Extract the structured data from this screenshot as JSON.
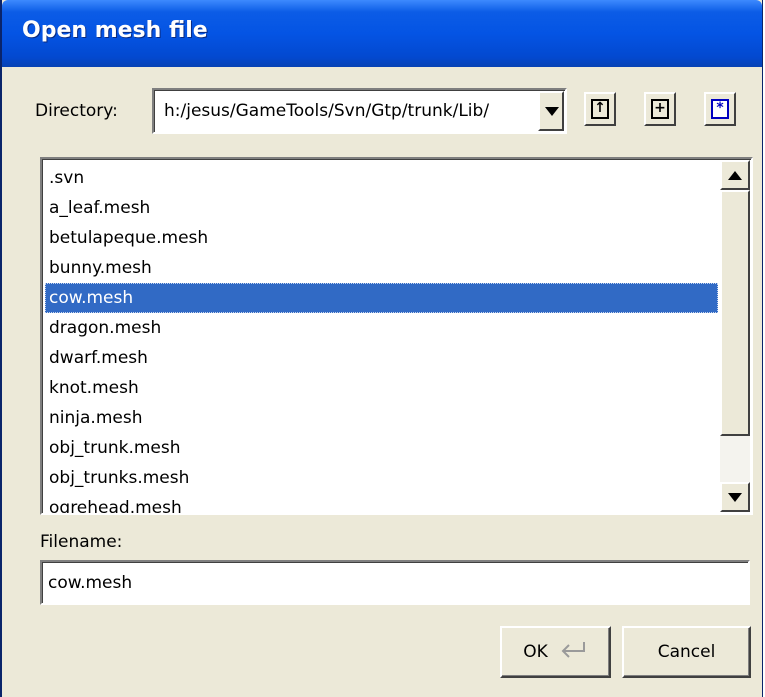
{
  "window": {
    "title": "Open mesh file"
  },
  "directory": {
    "label": "Directory:",
    "value": "h:/jesus/GameTools/Svn/Gtp/trunk/Lib/"
  },
  "toolbar": {
    "up_icon": "up-folder-icon",
    "new_folder_icon": "new-folder-icon",
    "filter_icon": "filter-icon"
  },
  "files": {
    "items": [
      ".svn",
      "a_leaf.mesh",
      "betulapeque.mesh",
      "bunny.mesh",
      "cow.mesh",
      "dragon.mesh",
      "dwarf.mesh",
      "knot.mesh",
      "ninja.mesh",
      "obj_trunk.mesh",
      "obj_trunks.mesh",
      "ogrehead.mesh"
    ],
    "selected": "cow.mesh"
  },
  "filename": {
    "label": "Filename:",
    "value": "cow.mesh"
  },
  "buttons": {
    "ok": "OK",
    "cancel": "Cancel"
  },
  "colors": {
    "selection": "#316ac5",
    "titlebar": "#0454e4",
    "face": "#ece9d8"
  }
}
